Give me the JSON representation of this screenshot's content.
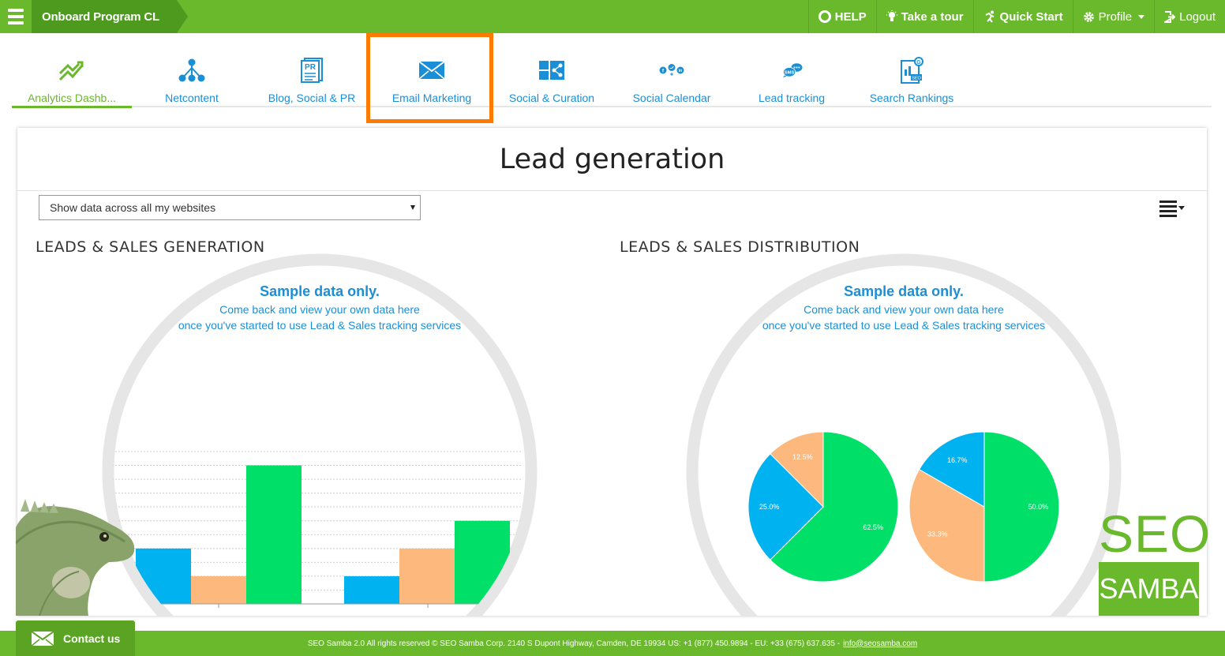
{
  "header": {
    "program": "Onboard Program CL",
    "nav": [
      {
        "label": "HELP",
        "icon": "lifebuoy-icon"
      },
      {
        "label": "Take a tour",
        "icon": "lightbulb-icon"
      },
      {
        "label": "Quick Start",
        "icon": "running-man-icon"
      },
      {
        "label": "Profile",
        "icon": "gear-icon"
      },
      {
        "label": "Logout",
        "icon": "logout-icon"
      }
    ]
  },
  "tabs": [
    {
      "label": "Analytics Dashb...",
      "icon": "trend-chart-icon",
      "active": true
    },
    {
      "label": "Netcontent",
      "icon": "network-icon"
    },
    {
      "label": "Blog, Social & PR",
      "icon": "pr-document-icon"
    },
    {
      "label": "Email Marketing",
      "icon": "envelope-icon"
    },
    {
      "label": "Social & Curation",
      "icon": "share-curation-icon"
    },
    {
      "label": "Social Calendar",
      "icon": "social-networks-icon"
    },
    {
      "label": "Lead tracking",
      "icon": "sms-chat-icon"
    },
    {
      "label": "Search Rankings",
      "icon": "seo-rankings-icon"
    }
  ],
  "panel": {
    "title": "Lead generation",
    "site_select": "Show data across all my websites"
  },
  "sections": {
    "left_title": "LEADS & SALES GENERATION",
    "right_title": "LEADS & SALES DISTRIBUTION",
    "sample_title": "Sample data only.",
    "sample_line1": "Come back and view your own data here",
    "sample_line2": "once you've started to use Lead & Sales tracking services"
  },
  "colors": {
    "brand_green": "#6ab82c",
    "link_blue": "#1b8fd6",
    "highlight_orange": "#ff7a00",
    "series_blue": "#00b2f0",
    "series_orange": "#fdb97d",
    "series_green": "#00e068"
  },
  "chart_data": [
    {
      "type": "bar",
      "categories": [
        "",
        ""
      ],
      "series": [
        {
          "color": "#00b2f0",
          "values": [
            2,
            1
          ]
        },
        {
          "color": "#fdb97d",
          "values": [
            1,
            2
          ]
        },
        {
          "color": "#00e068",
          "values": [
            5,
            3
          ]
        }
      ],
      "ylim": [
        0,
        5.5
      ],
      "grid": true
    },
    {
      "type": "pie",
      "slices": [
        {
          "label": "62.5%",
          "value": 62.5,
          "color": "#00e068"
        },
        {
          "label": "25.0%",
          "value": 25.0,
          "color": "#00b2f0"
        },
        {
          "label": "12.5%",
          "value": 12.5,
          "color": "#fdb97d"
        }
      ]
    },
    {
      "type": "pie",
      "slices": [
        {
          "label": "50.0%",
          "value": 50.0,
          "color": "#00e068"
        },
        {
          "label": "33.3%",
          "value": 33.3,
          "color": "#fdb97d"
        },
        {
          "label": "16.7%",
          "value": 16.7,
          "color": "#00b2f0"
        }
      ]
    }
  ],
  "footer": {
    "text": "SEO Samba 2.0  All rights reserved © SEO Samba Corp. 2140 S Dupont Highway, Camden, DE 19934 US: +1 (877) 450.9894 - EU: +33 (675) 637.635 -",
    "email": "info@seosamba.com",
    "contact": "Contact us"
  },
  "logo": {
    "top": "SEO",
    "bottom": "SAMBA"
  }
}
